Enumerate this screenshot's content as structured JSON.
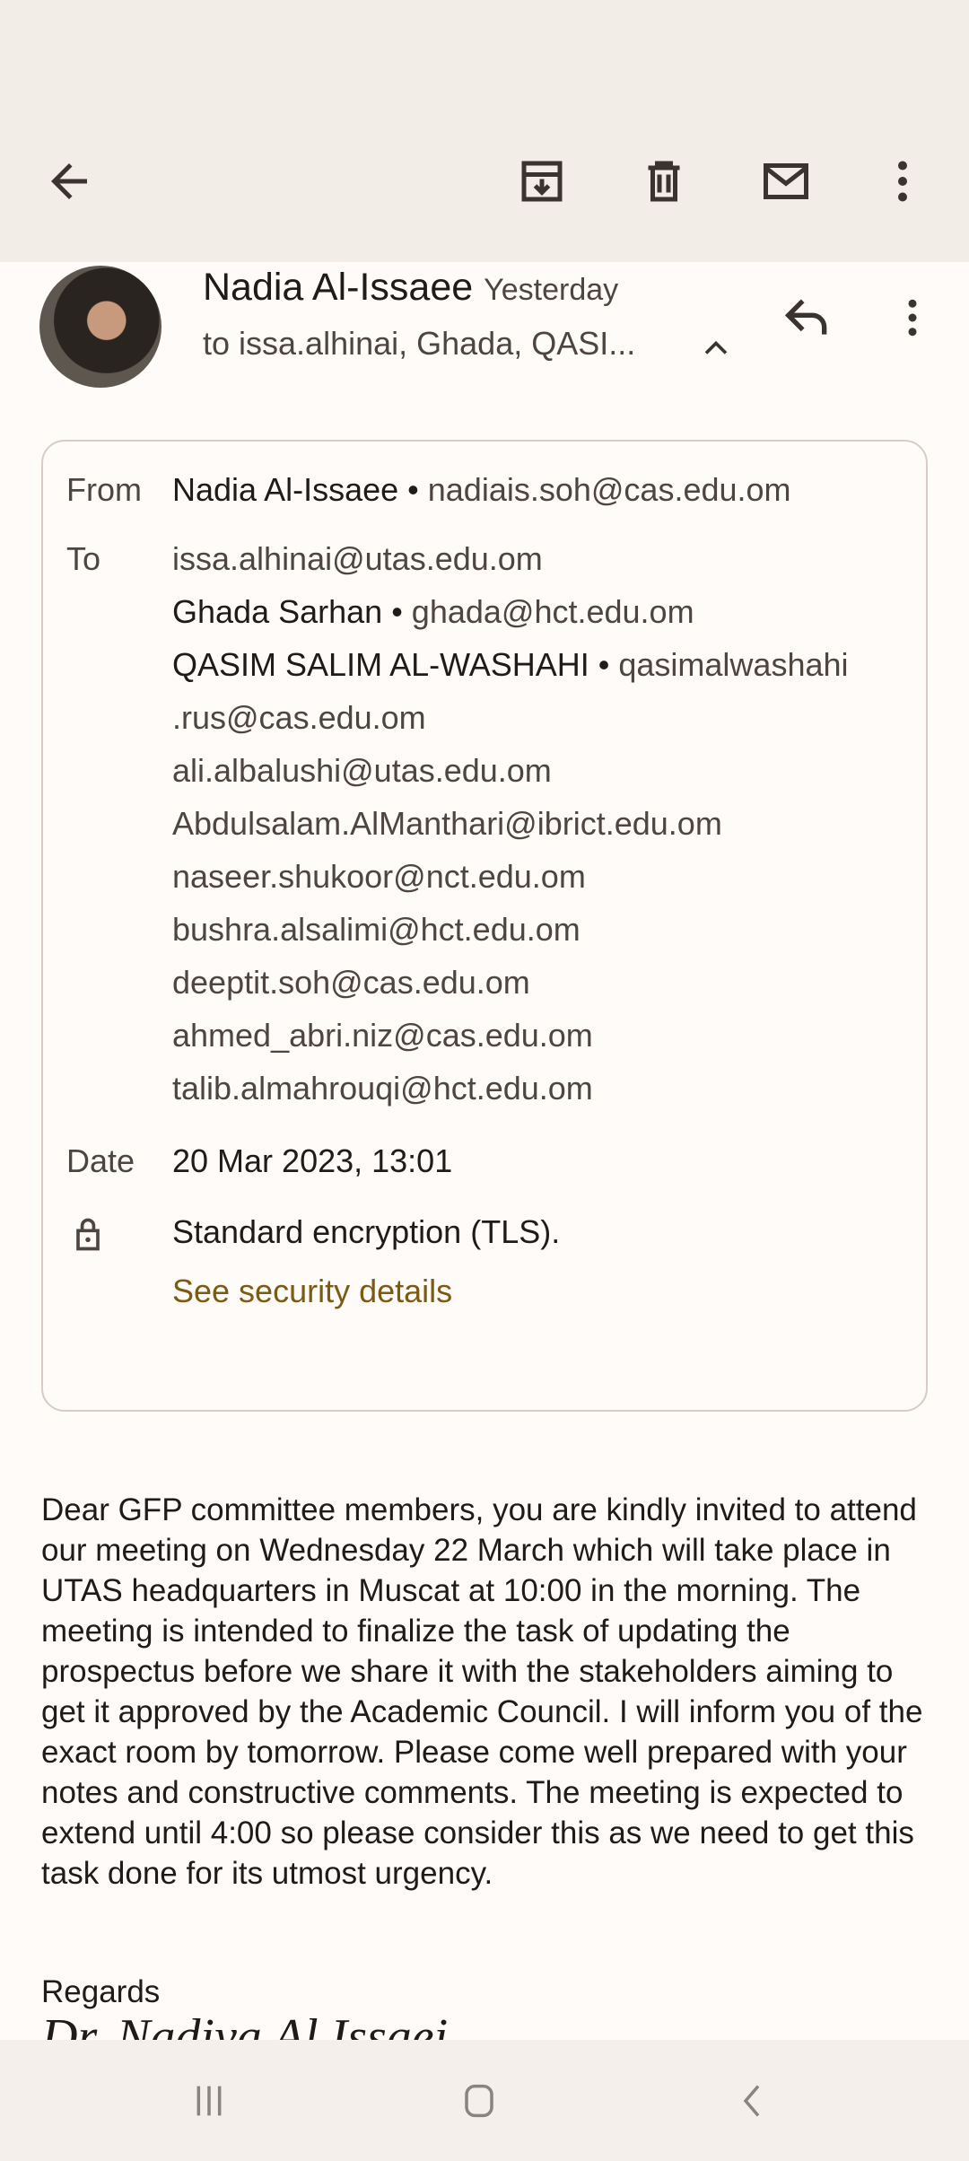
{
  "toolbar": {
    "back": "back-icon",
    "archive": "archive-icon",
    "delete": "delete-icon",
    "mark_unread": "mail-icon",
    "more": "more-vert-icon"
  },
  "message": {
    "sender_name": "Nadia Al-Issaee",
    "time": "Yesterday",
    "recipients_summary": "to issa.alhinai, Ghada, QASI...",
    "details": {
      "from_label": "From",
      "from_name": "Nadia Al-Issaee",
      "from_email": "nadiais.soh@cas.edu.om",
      "to_label": "To",
      "to": [
        {
          "name": "",
          "email": "issa.alhinai@utas.edu.om"
        },
        {
          "name": "Ghada Sarhan",
          "email": "ghada@hct.edu.om"
        },
        {
          "name": "QASIM SALIM AL-WASHAHI",
          "email": "qasimalwashahi"
        },
        {
          "name": "",
          "email": ".rus@cas.edu.om"
        },
        {
          "name": "",
          "email": "ali.albalushi@utas.edu.om"
        },
        {
          "name": "",
          "email": "Abdulsalam.AlManthari@ibrict.edu.om"
        },
        {
          "name": "",
          "email": "naseer.shukoor@nct.edu.om"
        },
        {
          "name": "",
          "email": "bushra.alsalimi@hct.edu.om"
        },
        {
          "name": "",
          "email": "deeptit.soh@cas.edu.om"
        },
        {
          "name": "",
          "email": "ahmed_abri.niz@cas.edu.om"
        },
        {
          "name": "",
          "email": "talib.almahrouqi@hct.edu.om"
        }
      ],
      "date_label": "Date",
      "date": "20 Mar 2023, 13:01",
      "encryption": "Standard encryption (TLS).",
      "security_link": "See security details"
    },
    "body": "Dear GFP committee members, you are kindly invited to attend our meeting on Wednesday 22 March which will take place in UTAS headquarters in Muscat at 10:00 in the morning. The meeting is intended to finalize the task of updating the prospectus before we share it with the stakeholders aiming to get it approved by the Academic Council. I will inform you of the exact room by tomorrow. Please come well prepared with your notes and constructive comments. The meeting is expected to extend until 4:00 so please consider this as we need to get this task done for its utmost urgency.",
    "regards": "Regards",
    "signature": "Dr. Nadiya Al Issaei"
  }
}
